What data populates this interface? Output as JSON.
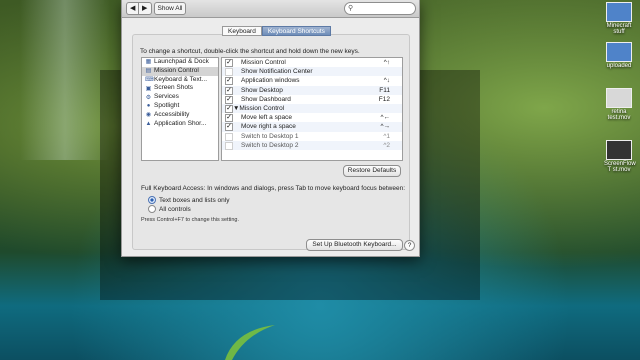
{
  "toolbar": {
    "show_all": "Show All"
  },
  "tabs": [
    {
      "label": "Keyboard",
      "active": false
    },
    {
      "label": "Keyboard Shortcuts",
      "active": true
    }
  ],
  "instruction": "To change a shortcut, double-click the shortcut and hold down the new keys.",
  "categories": [
    {
      "label": "Launchpad & Dock",
      "icon": "launchpad-icon"
    },
    {
      "label": "Mission Control",
      "icon": "mission-control-icon"
    },
    {
      "label": "Keyboard & Text...",
      "icon": "keyboard-icon"
    },
    {
      "label": "Screen Shots",
      "icon": "screenshot-icon"
    },
    {
      "label": "Services",
      "icon": "gear-icon"
    },
    {
      "label": "Spotlight",
      "icon": "spotlight-icon"
    },
    {
      "label": "Accessibility",
      "icon": "accessibility-icon"
    },
    {
      "label": "Application Shor...",
      "icon": "app-shortcuts-icon"
    }
  ],
  "shortcuts": [
    {
      "checked": true,
      "label": "Mission Control",
      "key": "^↑"
    },
    {
      "checked": false,
      "label": "Show Notification Center",
      "key": ""
    },
    {
      "checked": true,
      "label": "Application windows",
      "key": "^↓"
    },
    {
      "checked": true,
      "label": "Show Desktop",
      "key": "F11"
    },
    {
      "checked": true,
      "label": "Show Dashboard",
      "key": "F12"
    },
    {
      "checked": true,
      "label": "▼Mission Control",
      "key": ""
    },
    {
      "checked": true,
      "label": "Move left a space",
      "key": "^←"
    },
    {
      "checked": true,
      "label": "Move right a space",
      "key": "^→"
    },
    {
      "checked": false,
      "label": "Switch to Desktop 1",
      "key": "^1"
    },
    {
      "checked": false,
      "label": "Switch to Desktop 2",
      "key": "^2"
    }
  ],
  "restore_defaults": "Restore Defaults",
  "access": {
    "title": "Full Keyboard Access: In windows and dialogs, press Tab to move keyboard focus between:",
    "options": [
      {
        "label": "Text boxes and lists only",
        "selected": true
      },
      {
        "label": "All controls",
        "selected": false
      }
    ],
    "hint": "Press Control+F7 to change this setting."
  },
  "bluetooth_button": "Set Up Bluetooth Keyboard...",
  "help": "?",
  "desktop_icons": [
    {
      "label": "Minecraft stuff"
    },
    {
      "label": "uploaded"
    },
    {
      "label": "retina test.mov"
    },
    {
      "label": "ScreenFlow T st.mov"
    }
  ],
  "colors": {
    "accent": "#5d7aa5",
    "panel": "#ececec"
  }
}
